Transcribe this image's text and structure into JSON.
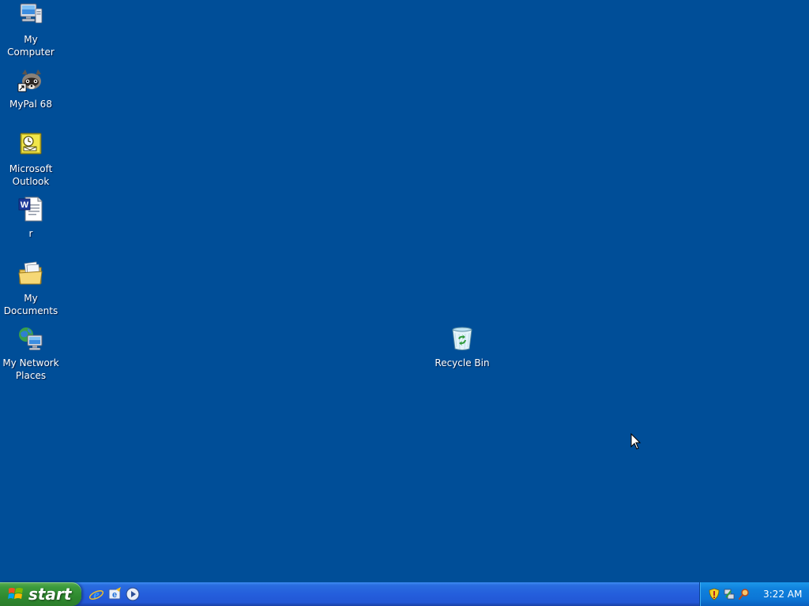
{
  "desktop": {
    "background_color": "#004e98",
    "icons": [
      {
        "name": "my-computer",
        "label": "My\nComputer",
        "icon": "my-computer-icon"
      },
      {
        "name": "mypal",
        "label": "MyPal 68",
        "icon": "mypal-raccoon-icon"
      },
      {
        "name": "outlook",
        "label": "Microsoft\nOutlook",
        "icon": "outlook-icon"
      },
      {
        "name": "word-doc-r",
        "label": "r",
        "icon": "word-document-icon"
      },
      {
        "name": "my-documents",
        "label": "My\nDocuments",
        "icon": "my-documents-folder-icon"
      },
      {
        "name": "my-network-places",
        "label": "My Network\nPlaces",
        "icon": "network-places-icon"
      },
      {
        "name": "recycle-bin",
        "label": "Recycle Bin",
        "icon": "recycle-bin-icon"
      }
    ]
  },
  "taskbar": {
    "start_label": "start",
    "quick_launch": [
      {
        "icon": "internet-explorer-icon"
      },
      {
        "icon": "outlook-express-icon"
      },
      {
        "icon": "media-player-icon"
      }
    ],
    "tray": {
      "icons": [
        {
          "icon": "security-shield-icon"
        },
        {
          "icon": "network-tray-icon"
        },
        {
          "icon": "search-magnifier-icon"
        }
      ],
      "clock": "3:22 AM"
    }
  }
}
